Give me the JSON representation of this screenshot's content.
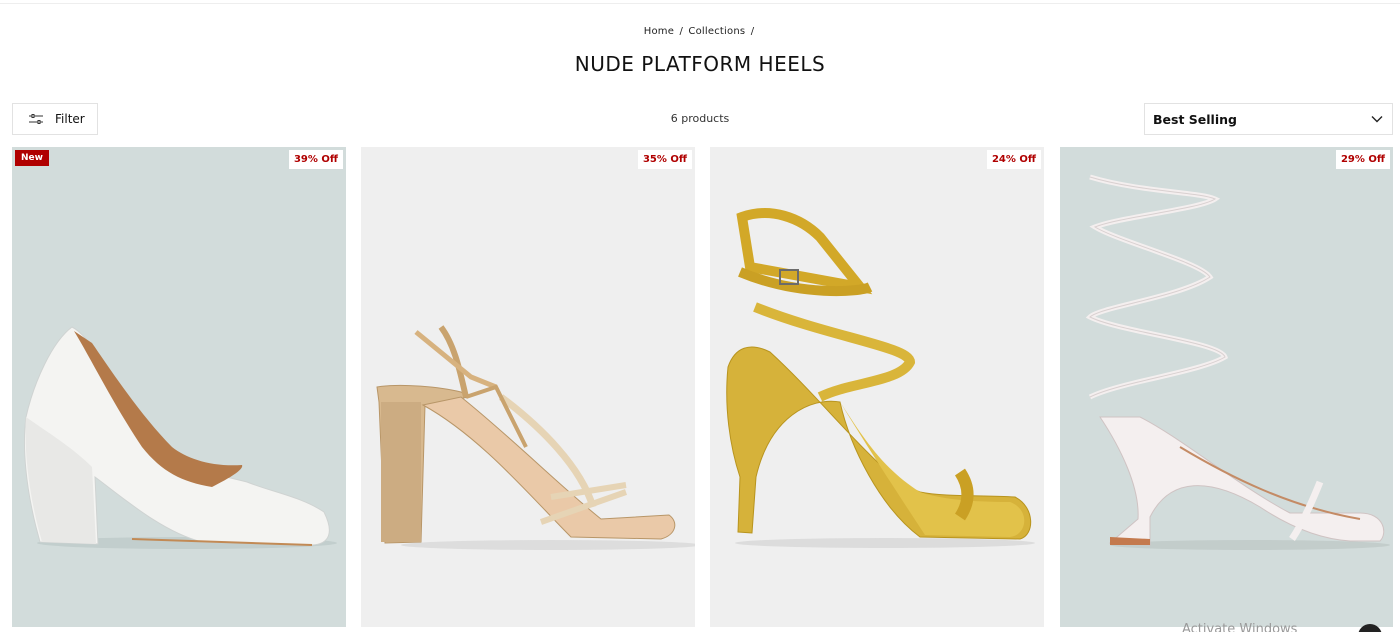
{
  "breadcrumb": {
    "home": "Home",
    "sep1": "/",
    "collections": "Collections",
    "sep2": "/"
  },
  "page_title": "NUDE PLATFORM HEELS",
  "toolbar": {
    "filter_label": "Filter",
    "product_count": "6 products",
    "sort_selected": "Best Selling"
  },
  "products": [
    {
      "badge_new": "New",
      "discount": "39% Off",
      "bg": "#d2dcdb",
      "image": "white-pointed-block-heel-pump"
    },
    {
      "discount": "35% Off",
      "bg": "#efefef",
      "image": "gold-rhinestone-strappy-block-heel-sandal"
    },
    {
      "discount": "24% Off",
      "bg": "#efefef",
      "image": "mustard-braided-ankle-strap-stiletto-sandal"
    },
    {
      "discount": "29% Off",
      "bg": "#d2dcdb",
      "image": "white-lace-up-flared-heel-sandal"
    }
  ],
  "colors": {
    "accent_red": "#b00000"
  },
  "os_overlay": {
    "watermark": "Activate Windows"
  }
}
